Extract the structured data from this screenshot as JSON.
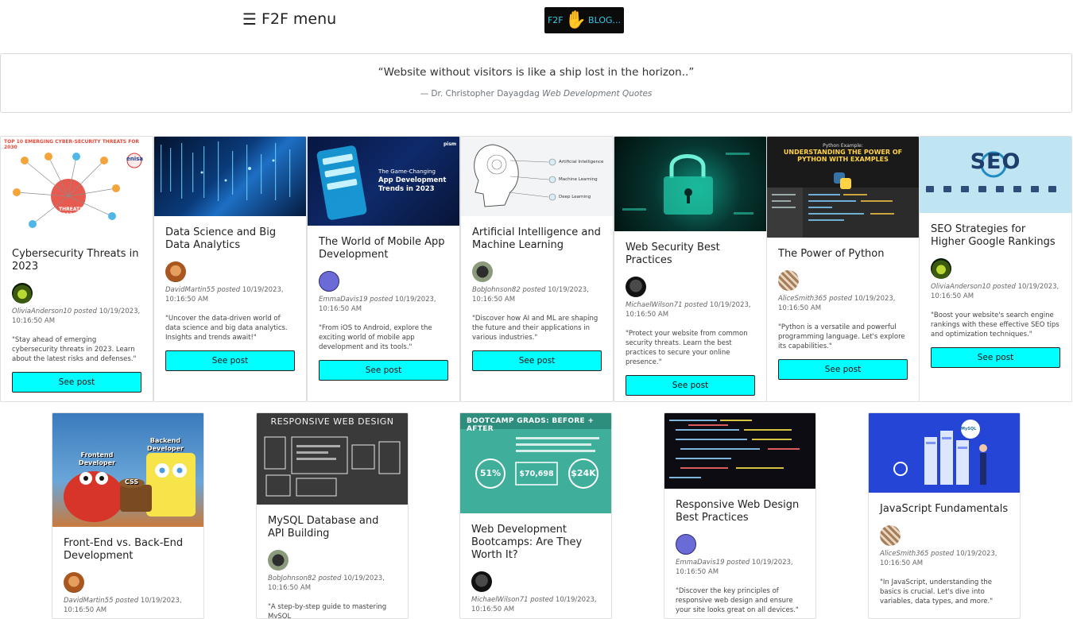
{
  "header": {
    "menu_label": "F2F menu",
    "logo_left": "F2F",
    "logo_right": "BLOG..."
  },
  "quote": {
    "text": "“Website without visitors is like a ship lost in the horizon..”",
    "author": "— Dr. Christopher Dayagdag",
    "source": "Web Development Quotes"
  },
  "button_label": "See post",
  "posted_word": "posted",
  "cards": [
    {
      "title": "Cybersecurity Threats in 2023",
      "author": "OliviaAnderson10",
      "date": "10/19/2023, 10:16:50 AM",
      "desc": "\"Stay ahead of emerging cybersecurity threats in 2023. Learn about the latest risks and defenses.\"",
      "img_text": "TOP 10 EMERGING CYBER-SECURITY THREATS FOR 2030",
      "img_sub": "THREATS 2030",
      "img_mark": "enisa"
    },
    {
      "title": "Data Science and Big Data Analytics",
      "author": "DavidMartin55",
      "date": "10/19/2023, 10:16:50 AM",
      "desc": "\"Uncover the data-driven world of data science and big data analytics. Insights and trends await!\""
    },
    {
      "title": "The World of Mobile App Development",
      "author": "EmmaDavis19",
      "date": "10/19/2023, 10:16:50 AM",
      "desc": "\"From iOS to Android, explore the exciting world of mobile app development and its tools.\"",
      "img_text": "The Game-Changing",
      "img_sub": "App Development Trends in 2023",
      "img_mark": "pism"
    },
    {
      "title": "Artificial Intelligence and Machine Learning",
      "author": "BobJohnson82",
      "date": "10/19/2023, 10:16:50 AM",
      "desc": "\"Discover how AI and ML are shaping the future and their applications in various industries.\"",
      "img_labels": [
        "Artificial Intelligence",
        "Machine Learning",
        "Deep Learning"
      ]
    },
    {
      "title": "Web Security Best Practices",
      "author": "MichaelWilson71",
      "date": "10/19/2023, 10:16:50 AM",
      "desc": "\"Protect your website from common security threats. Learn the best practices to secure your online presence.\""
    },
    {
      "title": "The Power of Python",
      "author": "AliceSmith365",
      "date": "10/19/2023, 10:16:50 AM",
      "desc": "\"Python is a versatile and powerful programming language. Let's explore its capabilities.\"",
      "img_text": "Python Example:",
      "img_sub": "UNDERSTANDING THE POWER OF PYTHON WITH EXAMPLES"
    },
    {
      "title": "SEO Strategies for Higher Google Rankings",
      "author": "OliviaAnderson10",
      "date": "10/19/2023, 10:16:50 AM",
      "desc": "\"Boost your website's search engine rankings with these effective SEO tips and optimization techniques.\"",
      "img_text": "SEO"
    },
    {
      "title": "Front-End vs. Back-End Development",
      "author": "DavidMartin55",
      "date": "10/19/2023, 10:16:50 AM",
      "desc": "",
      "img_labels": [
        "Frontend Developer",
        "Backend Developer",
        "CSS"
      ]
    },
    {
      "title": "MySQL Database and API Building",
      "author": "BobJohnson82",
      "date": "10/19/2023, 10:16:50 AM",
      "desc": "\"A step-by-step guide to mastering MySQL",
      "img_text": "RESPONSIVE WEB DESIGN"
    },
    {
      "title": "Web Development Bootcamps: Are They Worth It?",
      "author": "MichaelWilson71",
      "date": "10/19/2023, 10:16:50 AM",
      "desc": "",
      "img_text": "BOOTCAMP GRADS: BEFORE + AFTER",
      "img_labels": [
        "51%",
        "$70,698",
        "$24K"
      ]
    },
    {
      "title": "Responsive Web Design Best Practices",
      "author": "EmmaDavis19",
      "date": "10/19/2023, 10:16:50 AM",
      "desc": "\"Discover the key principles of responsive web design and ensure your site looks great on all devices.\""
    },
    {
      "title": "JavaScript Fundamentals",
      "author": "AliceSmith365",
      "date": "10/19/2023, 10:16:50 AM",
      "desc": "\"In JavaScript, understanding the basics is crucial. Let's dive into variables, data types, and more.\"",
      "img_mark": "MySQL"
    }
  ]
}
